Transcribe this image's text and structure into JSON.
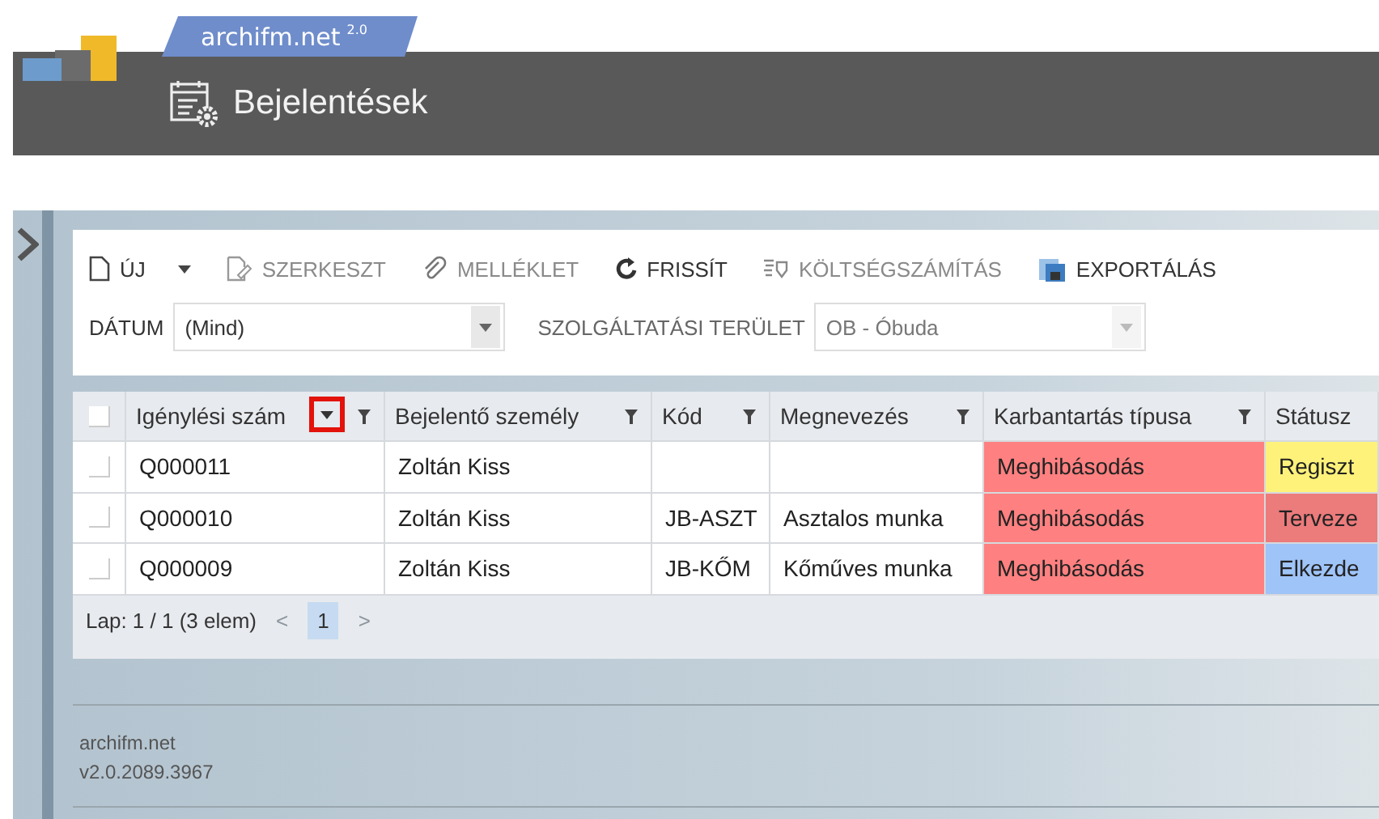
{
  "brand": {
    "name": "archifm.net",
    "version": "2.0"
  },
  "page_title": "Bejelentések",
  "toolbar": [
    {
      "label": "ÚJ",
      "kind": "new",
      "disabled": false,
      "dropdown": true
    },
    {
      "label": "SZERKESZT",
      "kind": "edit",
      "disabled": true,
      "dropdown": false
    },
    {
      "label": "MELLÉKLET",
      "kind": "attach",
      "disabled": true,
      "dropdown": false
    },
    {
      "label": "FRISSÍT",
      "kind": "refresh",
      "disabled": false,
      "dropdown": false
    },
    {
      "label": "KÖLTSÉGSZÁMÍTÁS",
      "kind": "cost",
      "disabled": true,
      "dropdown": false
    },
    {
      "label": "EXPORTÁLÁS",
      "kind": "export",
      "disabled": false,
      "dropdown": false
    }
  ],
  "filters": [
    {
      "label": "DÁTUM",
      "value": "(Mind)",
      "disabled": false
    },
    {
      "label": "SZOLGÁLTATÁSI TERÜLET",
      "value": "OB - Óbuda",
      "disabled": true
    }
  ],
  "table": {
    "columns": [
      {
        "label": "Igénylési szám",
        "highlighted": true
      },
      {
        "label": "Bejelentő személy",
        "highlighted": false
      },
      {
        "label": "Kód",
        "highlighted": false
      },
      {
        "label": "Megnevezés",
        "highlighted": false
      },
      {
        "label": "Karbantartás típusa",
        "highlighted": false
      },
      {
        "label": "Státusz",
        "highlighted": false
      }
    ],
    "select_all_checked": false,
    "rows": [
      {
        "checked": false,
        "cells": [
          {
            "text": "Q000011"
          },
          {
            "text": "Zoltán Kiss"
          },
          {
            "text": ""
          },
          {
            "text": ""
          },
          {
            "text": "Meghibásodás",
            "color": "#ff8080"
          },
          {
            "text": "Regiszt",
            "color": "#fff27a"
          }
        ]
      },
      {
        "checked": false,
        "cells": [
          {
            "text": "Q000010"
          },
          {
            "text": "Zoltán Kiss"
          },
          {
            "text": "JB-ASZT"
          },
          {
            "text": "Asztalos munka"
          },
          {
            "text": "Meghibásodás",
            "color": "#ff8080"
          },
          {
            "text": "Terveze",
            "color": "#ec7b7b"
          }
        ]
      },
      {
        "checked": false,
        "cells": [
          {
            "text": "Q000009"
          },
          {
            "text": "Zoltán Kiss"
          },
          {
            "text": "JB-KŐM"
          },
          {
            "text": "Kőműves munka"
          },
          {
            "text": "Meghibásodás",
            "color": "#ff8080"
          },
          {
            "text": "Elkezde",
            "color": "#9fc4f8"
          }
        ]
      }
    ]
  },
  "pager": {
    "summary": "Lap: 1 / 1 (3 elem)",
    "prev": "<",
    "next": ">",
    "pages": [
      {
        "label": "1",
        "selected": true
      }
    ]
  },
  "footer": {
    "product": "archifm.net",
    "version": "v2.0.2089.3967"
  }
}
